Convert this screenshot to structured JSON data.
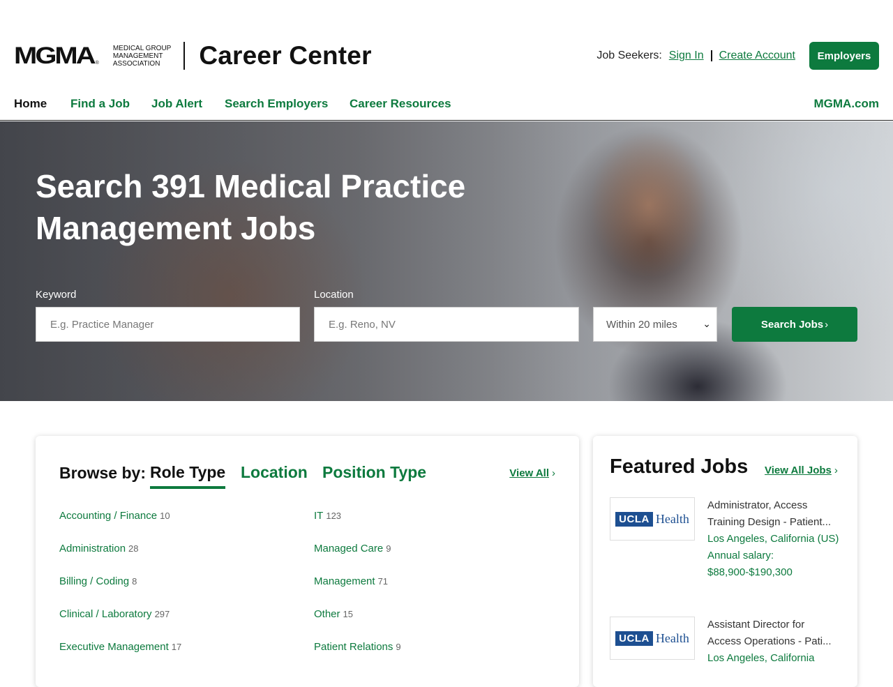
{
  "header": {
    "logo_mark": "MGMA",
    "logo_reg": "®",
    "logo_sub": [
      "MEDICAL GROUP",
      "MANAGEMENT",
      "ASSOCIATION"
    ],
    "logo_title": "Career Center",
    "job_seekers_label": "Job Seekers:",
    "sign_in": "Sign In",
    "create_account": "Create Account",
    "employers_button": "Employers"
  },
  "nav": {
    "items": [
      "Home",
      "Find a Job",
      "Job Alert",
      "Search Employers",
      "Career Resources"
    ],
    "external": "MGMA.com"
  },
  "hero": {
    "title": "Search 391 Medical Practice Management Jobs",
    "keyword_label": "Keyword",
    "keyword_placeholder": "E.g. Practice Manager",
    "location_label": "Location",
    "location_placeholder": "E.g. Reno, NV",
    "radius_selected": "Within 20 miles",
    "search_button": "Search Jobs"
  },
  "browse": {
    "label": "Browse by:",
    "tabs": [
      "Role Type",
      "Location",
      "Position Type"
    ],
    "view_all": "View All",
    "left_column": [
      {
        "name": "Accounting / Finance",
        "count": "10"
      },
      {
        "name": "Administration",
        "count": "28"
      },
      {
        "name": "Billing / Coding",
        "count": "8"
      },
      {
        "name": "Clinical / Laboratory",
        "count": "297"
      },
      {
        "name": "Executive Management",
        "count": "17"
      }
    ],
    "right_column": [
      {
        "name": "IT",
        "count": "123"
      },
      {
        "name": "Managed Care",
        "count": "9"
      },
      {
        "name": "Management",
        "count": "71"
      },
      {
        "name": "Other",
        "count": "15"
      },
      {
        "name": "Patient Relations",
        "count": "9"
      }
    ]
  },
  "featured": {
    "title": "Featured Jobs",
    "view_all": "View All Jobs",
    "jobs": [
      {
        "logo_a": "UCLA",
        "logo_b": "Health",
        "title": "Administrator, Access Training Design - Patient...",
        "location": "Los Angeles, California (US)",
        "salary": "Annual salary: $88,900-$190,300"
      },
      {
        "logo_a": "UCLA",
        "logo_b": "Health",
        "title": "Assistant Director for Access Operations - Pati...",
        "location": "Los Angeles, California"
      }
    ]
  },
  "colors": {
    "brand_green": "#0d7a3e",
    "ucla_blue": "#1d4f91"
  }
}
